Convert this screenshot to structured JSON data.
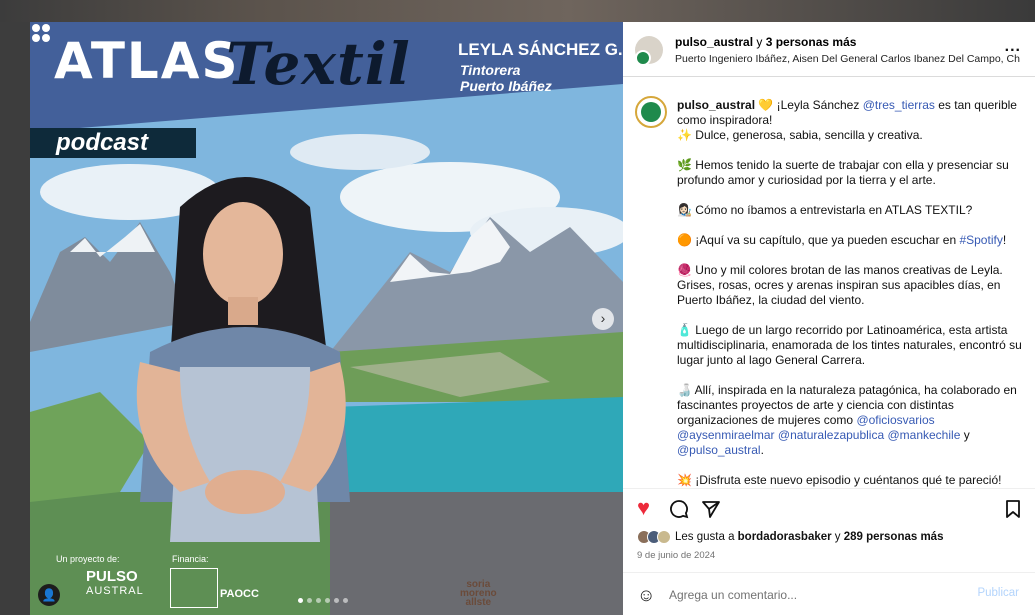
{
  "post_image": {
    "title_part1": "ATLAS",
    "title_part2": "Textil",
    "author": "LEYLA SÁNCHEZ G.",
    "role_line1": "Tintorera",
    "role_line2": "Puerto Ibáñez",
    "podcast_tag": "podcast",
    "project_label": "Un proyecto de:",
    "brand_name": "PULSO",
    "brand_sub": "AUSTRAL",
    "financia_label": "Financia:",
    "funder_name": "PAOCC",
    "artist_signature": "soria moreno allste",
    "avatar_initial": "👤",
    "next_arrow": "›",
    "carousel_count": 6,
    "carousel_index": 0
  },
  "header": {
    "username": "pulso_austral",
    "connector": " y ",
    "others": "3 personas más",
    "location": "Puerto Ingeniero Ibáñez, Aisen Del General Carlos Ibanez Del Campo, Ch",
    "more_icon": "..."
  },
  "caption": {
    "username": "pulso_austral",
    "lines": [
      {
        "type": "intro",
        "pre": " 💛 ¡Leyla Sánchez ",
        "mention": "@tres_tierras",
        "post": " es tan querible como inspiradora!"
      },
      {
        "text": "✨ Dulce, generosa, sabia, sencilla y creativa."
      }
    ],
    "p2": "🌿 Hemos tenido la suerte de trabajar con ella y presenciar su profundo amor y curiosidad por la tierra y el arte.",
    "p3": "👩🏻‍🎨 Cómo no íbamos a entrevistarla en ATLAS TEXTIL?",
    "p4_pre": "🟠 ¡Aquí va su capítulo, que ya pueden escuchar en ",
    "p4_link": "#Spotify",
    "p4_post": "!",
    "p5": "🧶 Uno y mil colores brotan de las manos creativas de Leyla. Grises, rosas, ocres y arenas inspiran sus apacibles días, en Puerto Ibáñez, la ciudad del viento.",
    "p6": "🧴 Luego de un largo recorrido por Latinoamérica, esta artista multidisciplinaria, enamorada de los tintes naturales, encontró su lugar junto al lago General Carrera.",
    "p7_pre": "🍶 Allí, inspirada en la naturaleza patagónica, ha colaborado en fascinantes proyectos de arte y ciencia con distintas organizaciones de mujeres como ",
    "p7_m1": "@oficiosvarios",
    "p7_m2": "@aysenmiraelmar",
    "p7_m3": "@naturalezapublica",
    "p7_m4": "@mankechile",
    "p7_and": " y ",
    "p7_m5": "@pulso_austral",
    "p7_end": ".",
    "p8": "💥 ¡Disfruta este nuevo episodio y cuéntanos qué te pareció!"
  },
  "actions": {
    "like_icon": "♥",
    "comment_icon": "○",
    "share_icon": "➤",
    "save_icon": "▯"
  },
  "likes": {
    "pre": "Les gusta a ",
    "user": "bordadorasbaker",
    "mid": " y ",
    "count": "289 personas más"
  },
  "date": "9 de junio de 2024",
  "comment_box": {
    "emoji_icon": "☺",
    "placeholder": "Agrega un comentario...",
    "post_label": "Publicar"
  },
  "colors": {
    "like_red": "#ed2a3b",
    "link_blue": "#375ab4",
    "post_disabled": "#b3d4fc"
  }
}
